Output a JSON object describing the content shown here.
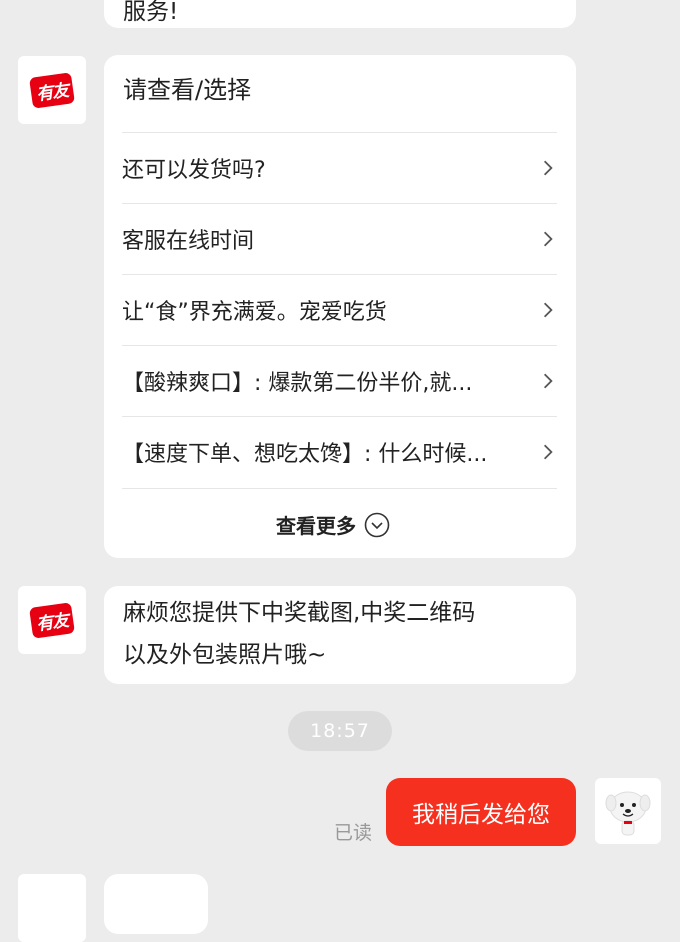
{
  "prev_message": {
    "text": "服务!"
  },
  "shop": {
    "logo_text": "有友"
  },
  "menu_card": {
    "title": "请查看/选择",
    "items": [
      {
        "label": "还可以发货吗?"
      },
      {
        "label": "客服在线时间"
      },
      {
        "label": "让“食”界充满爱。宠爱吃货"
      },
      {
        "label": "【酸辣爽口】: 爆款第二份半价,就..."
      },
      {
        "label": "【速度下单、想吃太馋】: 什么时候..."
      }
    ],
    "more_label": "查看更多"
  },
  "agent_message": {
    "line1": "麻烦您提供下中奖截图,中奖二维码",
    "line2": "以及外包装照片哦~"
  },
  "timestamp": "18:57",
  "user_message": {
    "text": "我稍后发给您",
    "status": "已读"
  },
  "colors": {
    "accent": "#f5301f",
    "logo_red": "#e60012",
    "background": "#ececec"
  },
  "icons": [
    "chevron-right-icon",
    "chevron-down-circle-icon",
    "user-avatar-dog-icon"
  ]
}
